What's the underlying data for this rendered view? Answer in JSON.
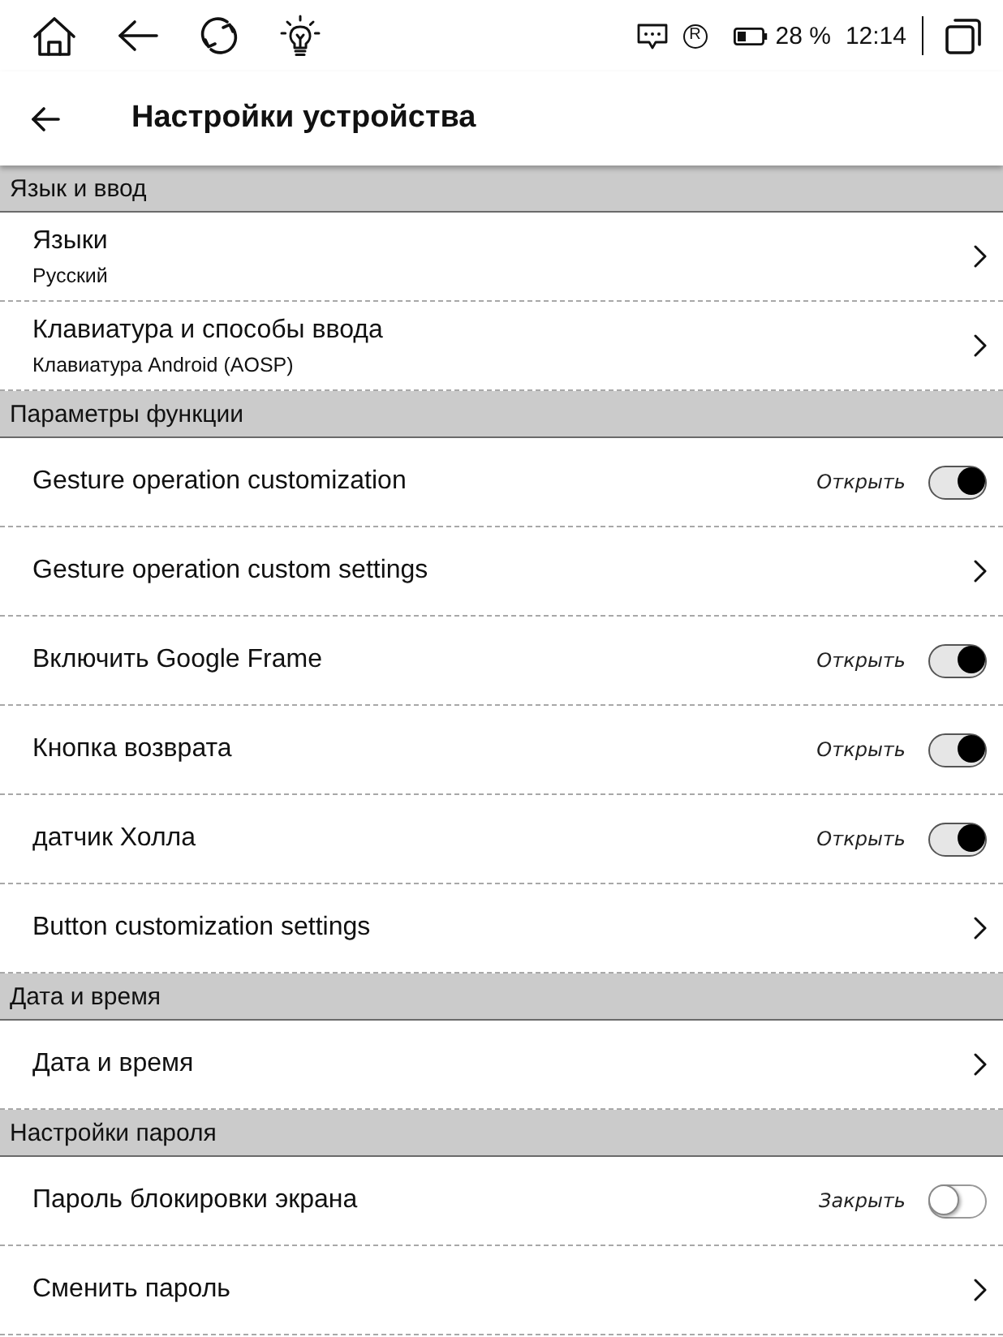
{
  "status_bar": {
    "indicator": "R",
    "battery": "28 %",
    "time": "12:14"
  },
  "header": {
    "title": "Настройки устройства"
  },
  "sections": [
    {
      "title": "Язык и ввод",
      "items": [
        {
          "kind": "link",
          "title": "Языки",
          "subtitle": "Русский"
        },
        {
          "kind": "link",
          "title": "Клавиатура и способы ввода",
          "subtitle": "Клавиатура Android (AOSP)"
        }
      ]
    },
    {
      "title": "Параметры функции",
      "items": [
        {
          "kind": "toggle",
          "title": "Gesture operation customization",
          "state_label": "Открыть",
          "on": true
        },
        {
          "kind": "link",
          "title": "Gesture operation custom settings"
        },
        {
          "kind": "toggle",
          "title": "Включить Google Frame",
          "state_label": "Открыть",
          "on": true
        },
        {
          "kind": "toggle",
          "title": "Кнопка возврата",
          "state_label": "Открыть",
          "on": true
        },
        {
          "kind": "toggle",
          "title": "датчик Холла",
          "state_label": "Открыть",
          "on": true
        },
        {
          "kind": "link",
          "title": "Button customization settings"
        }
      ]
    },
    {
      "title": "Дата и время",
      "items": [
        {
          "kind": "link",
          "title": "Дата и время"
        }
      ]
    },
    {
      "title": "Настройки пароля",
      "items": [
        {
          "kind": "toggle",
          "title": "Пароль блокировки экрана",
          "state_label": "Закрыть",
          "on": false
        },
        {
          "kind": "link",
          "title": "Сменить пароль"
        }
      ]
    }
  ]
}
